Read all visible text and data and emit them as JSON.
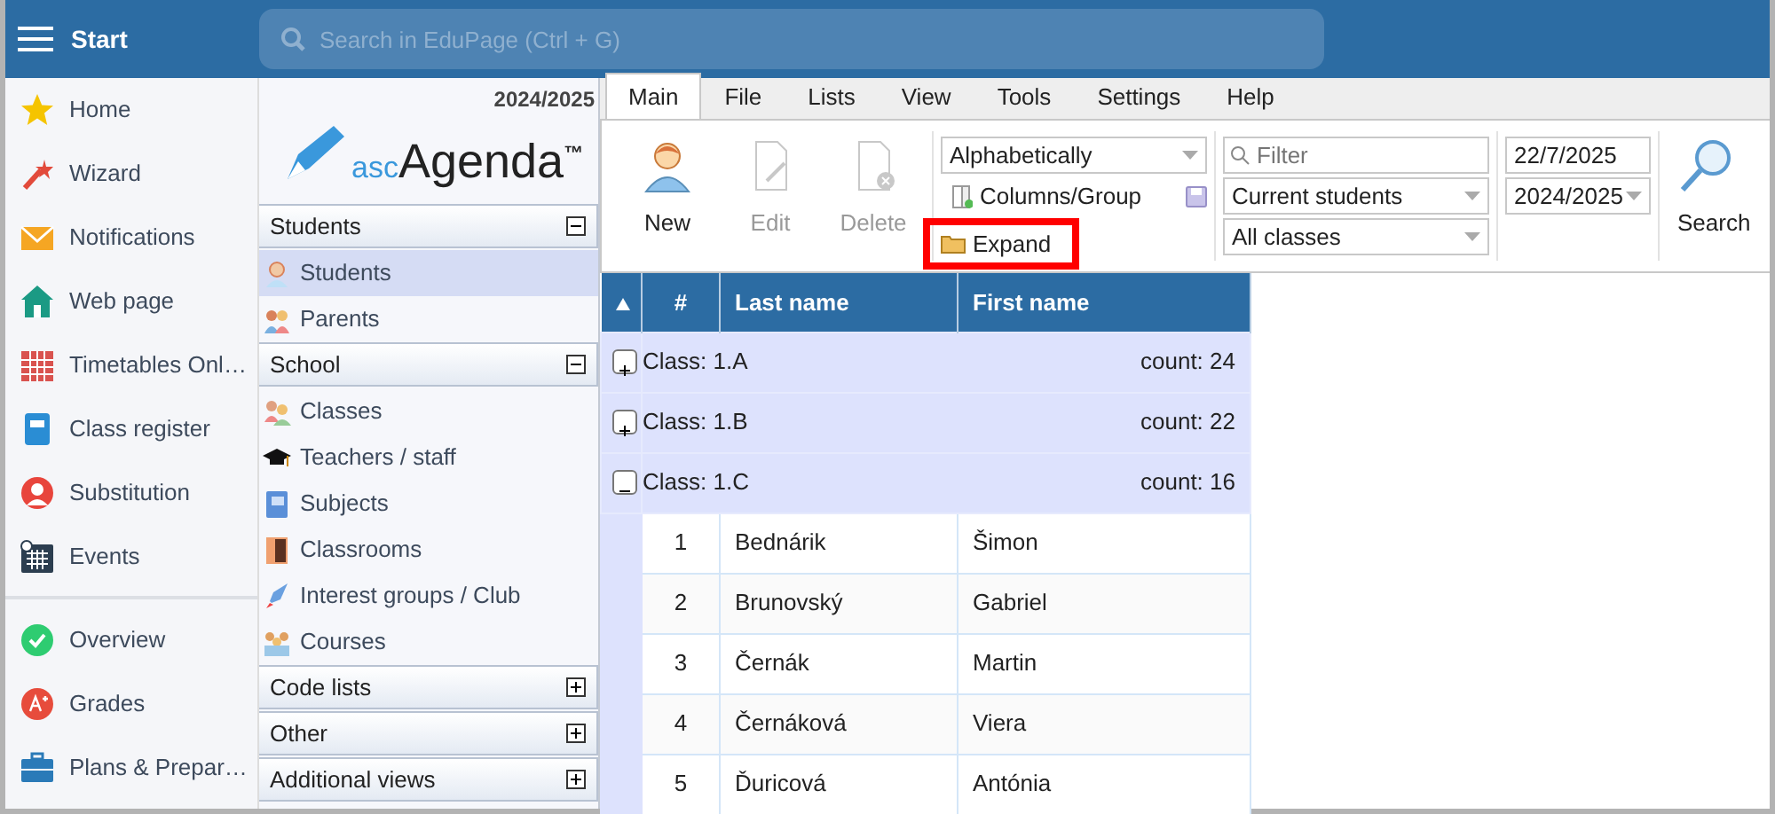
{
  "topbar": {
    "menu_label": "Start",
    "search_placeholder": "Search in EduPage (Ctrl + G)"
  },
  "sidebar": {
    "groups": [
      {
        "items": [
          {
            "label": "Home"
          },
          {
            "label": "Wizard"
          },
          {
            "label": "Notifications"
          },
          {
            "label": "Web page"
          },
          {
            "label": "Timetables Onl…"
          },
          {
            "label": "Class register"
          },
          {
            "label": "Substitution"
          },
          {
            "label": "Events"
          }
        ]
      },
      {
        "items": [
          {
            "label": "Overview"
          },
          {
            "label": "Grades"
          },
          {
            "label": "Plans & Prepar…"
          }
        ]
      }
    ]
  },
  "nav_panel": {
    "year": "2024/2025",
    "logo": {
      "prefix": "asc",
      "name": "Agenda",
      "mark": "™"
    },
    "sections": [
      {
        "title": "Students",
        "expanded": true,
        "items": [
          {
            "label": "Students",
            "selected": true
          },
          {
            "label": "Parents",
            "selected": false
          }
        ]
      },
      {
        "title": "School",
        "expanded": true,
        "items": [
          {
            "label": "Classes",
            "selected": false
          },
          {
            "label": "Teachers / staff",
            "selected": false
          },
          {
            "label": "Subjects",
            "selected": false
          },
          {
            "label": "Classrooms",
            "selected": false
          },
          {
            "label": "Interest groups / Club",
            "selected": false
          },
          {
            "label": "Courses",
            "selected": false
          }
        ]
      },
      {
        "title": "Code lists",
        "expanded": false
      },
      {
        "title": "Other",
        "expanded": false
      },
      {
        "title": "Additional views",
        "expanded": false
      }
    ]
  },
  "ribbon": {
    "tabs": [
      {
        "label": "Main",
        "selected": true
      },
      {
        "label": "File",
        "selected": false
      },
      {
        "label": "Lists",
        "selected": false
      },
      {
        "label": "View",
        "selected": false
      },
      {
        "label": "Tools",
        "selected": false
      },
      {
        "label": "Settings",
        "selected": false
      },
      {
        "label": "Help",
        "selected": false
      }
    ],
    "buttons": [
      {
        "label": "New",
        "disabled": false
      },
      {
        "label": "Edit",
        "disabled": true
      },
      {
        "label": "Delete",
        "disabled": true
      }
    ],
    "sort_select": "Alphabetically",
    "columns_group": "Columns/Group",
    "expand": {
      "label": "Expand",
      "highlighted": true
    },
    "filter": {
      "placeholder": "Filter"
    },
    "selects": [
      "Current students",
      "All classes"
    ],
    "date": "22/7/2025",
    "year_select": "2024/2025",
    "search_button": "Search"
  },
  "table": {
    "columns": [
      "#",
      "Last name",
      "First name"
    ],
    "groups": [
      {
        "label": "Class: 1.A",
        "count": "count: 24",
        "expanded": false
      },
      {
        "label": "Class: 1.B",
        "count": "count: 22",
        "expanded": false
      },
      {
        "label": "Class: 1.C",
        "count": "count: 16",
        "expanded": true,
        "rows": [
          [
            "1",
            "Bednárik",
            "Šimon"
          ],
          [
            "2",
            "Brunovský",
            "Gabriel"
          ],
          [
            "3",
            "Černák",
            "Martin"
          ],
          [
            "4",
            "Černáková",
            "Viera"
          ],
          [
            "5",
            "Ďuricová",
            "Antónia"
          ]
        ]
      }
    ]
  }
}
